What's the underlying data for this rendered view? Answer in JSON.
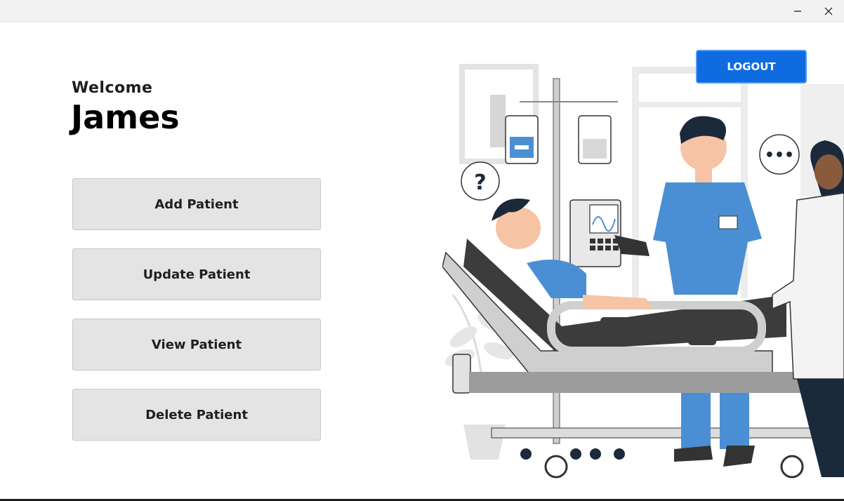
{
  "window": {
    "minimize_glyph": "—",
    "close_glyph": "✕"
  },
  "header": {
    "welcome": "Welcome",
    "user_name": "James"
  },
  "actions": [
    {
      "label": "Add Patient"
    },
    {
      "label": "Update Patient"
    },
    {
      "label": "View Patient"
    },
    {
      "label": "Delete Patient"
    }
  ],
  "logout": {
    "label": "LOGOUT"
  },
  "illustration": {
    "question_mark": "?",
    "speech_dots": "•••"
  },
  "colors": {
    "accent": "#0e6be0",
    "button_bg": "#e4e4e4",
    "scrubs": "#4a8fd4"
  }
}
